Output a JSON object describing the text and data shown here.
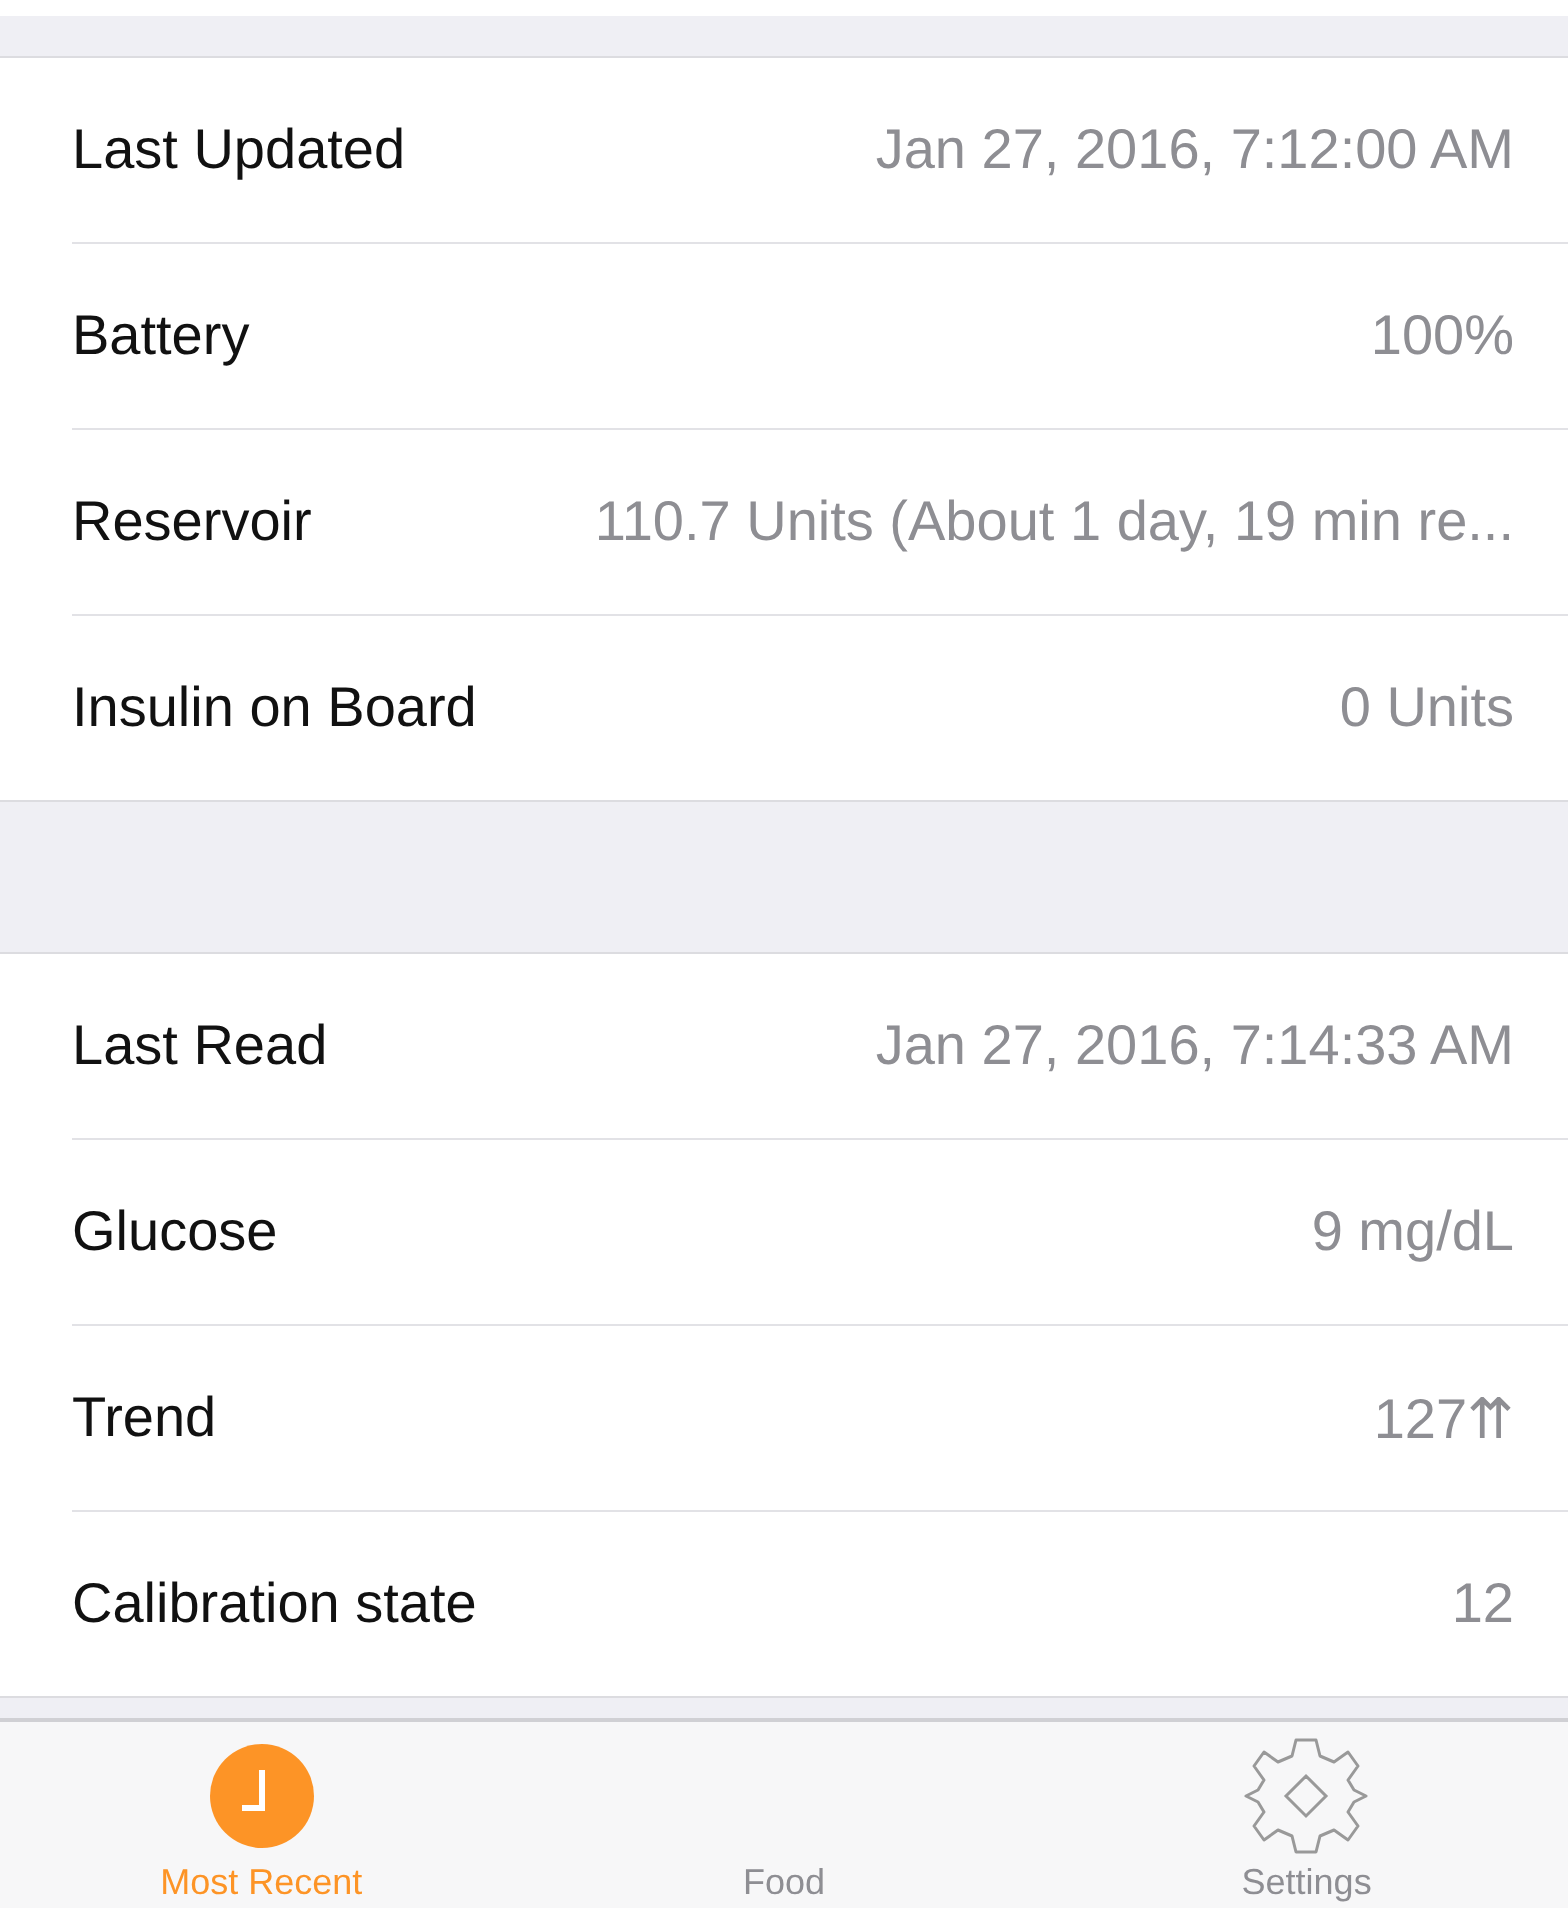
{
  "sections": [
    {
      "rows": [
        {
          "label": "Last Updated",
          "value": "Jan 27, 2016, 7:12:00 AM"
        },
        {
          "label": "Battery",
          "value": "100%"
        },
        {
          "label": "Reservoir",
          "value": "110.7 Units (About 1 day, 19 min re..."
        },
        {
          "label": "Insulin on Board",
          "value": "0 Units"
        }
      ]
    },
    {
      "rows": [
        {
          "label": "Last Read",
          "value": "Jan 27, 2016, 7:14:33 AM"
        },
        {
          "label": "Glucose",
          "value": "9 mg/dL"
        },
        {
          "label": "Trend",
          "value": "127⇈"
        },
        {
          "label": "Calibration state",
          "value": "12"
        }
      ]
    }
  ],
  "tabs": [
    {
      "label": "Most Recent",
      "kind": "clock",
      "selected": true
    },
    {
      "label": "Food",
      "kind": "blank",
      "selected": false
    },
    {
      "label": "Settings",
      "kind": "gear",
      "selected": false
    }
  ]
}
